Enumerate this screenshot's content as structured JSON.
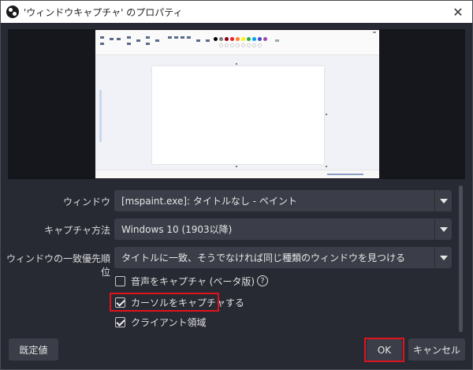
{
  "window": {
    "title": "'ウィンドウキャプチャ' のプロパティ"
  },
  "form": {
    "window_label": "ウィンドウ",
    "window_value": "[mspaint.exe]: タイトルなし - ペイント",
    "capture_method_label": "キャプチャ方法",
    "capture_method_value": "Windows 10 (1903以降)",
    "priority_label": "ウィンドウの一致優先順位",
    "priority_value": "タイトルに一致、そうでなければ同じ種類のウィンドウを見つける"
  },
  "checkboxes": {
    "audio_label": "音声をキャプチャ (ベータ版)",
    "audio_checked": false,
    "cursor_label": "カーソルをキャプチャする",
    "cursor_checked": true,
    "client_label": "クライアント領域",
    "client_checked": true
  },
  "buttons": {
    "defaults": "既定値",
    "ok": "OK",
    "cancel": "キャンセル"
  },
  "icons": {
    "app": "obs-icon",
    "close": "close-icon",
    "help": "help-icon"
  },
  "colors": {
    "highlight": "#e0141d",
    "background": "#272a33",
    "control": "#3b3e48"
  }
}
